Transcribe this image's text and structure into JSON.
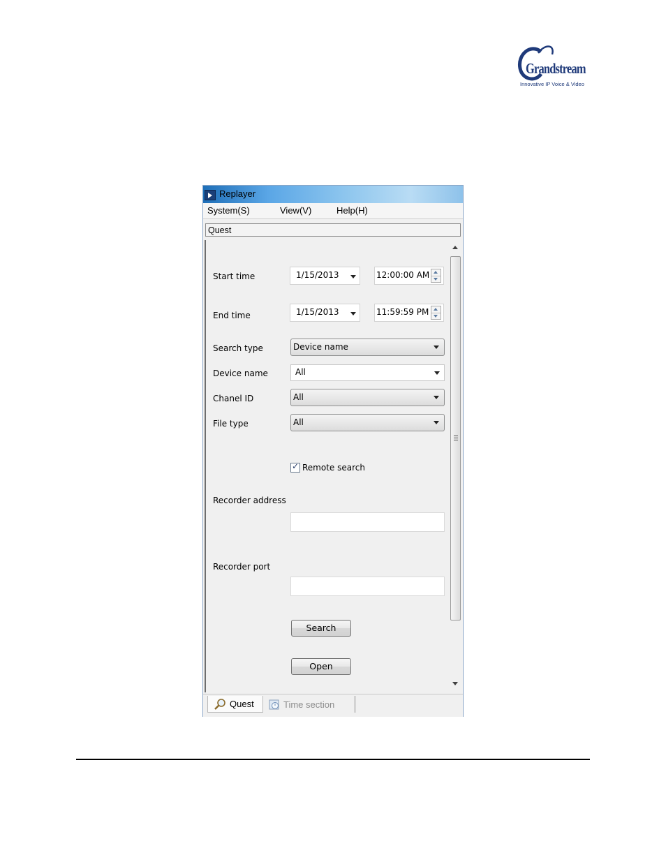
{
  "logo": {
    "text": "Grandstream",
    "tagline": "Innovative IP Voice & Video"
  },
  "window": {
    "title": "Replayer",
    "menu": [
      {
        "label": "System(S)"
      },
      {
        "label": "View(V)"
      },
      {
        "label": "Help(H)"
      }
    ],
    "section_title": "Quest"
  },
  "form": {
    "start_time": {
      "label": "Start time",
      "date": "1/15/2013",
      "time": "12:00:00 AM"
    },
    "end_time": {
      "label": "End time",
      "date": "1/15/2013",
      "time": "11:59:59 PM"
    },
    "search_type": {
      "label": "Search type",
      "value": "Device name"
    },
    "device_name": {
      "label": "Device name",
      "value": "All"
    },
    "channel_id": {
      "label": "Chanel ID",
      "value": "All"
    },
    "file_type": {
      "label": "File type",
      "value": "All"
    },
    "remote_search": {
      "label": "Remote search",
      "checked": true
    },
    "recorder_address": {
      "label": "Recorder address",
      "value": ""
    },
    "recorder_port": {
      "label": "Recorder port",
      "value": ""
    },
    "search_button": "Search",
    "open_button": "Open"
  },
  "tabs": [
    {
      "label": "Quest",
      "active": true
    },
    {
      "label": "Time section",
      "active": false
    }
  ]
}
